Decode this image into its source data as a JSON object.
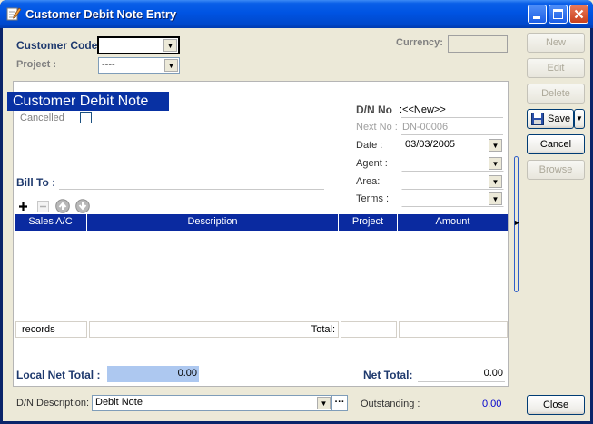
{
  "window": {
    "title": "Customer Debit Note Entry",
    "icon": "edit-icon"
  },
  "header": {
    "customer_code_label": "Customer Code:",
    "customer_code_value": "",
    "project_label": "Project :",
    "project_value": "----",
    "currency_label": "Currency:",
    "currency_value": ""
  },
  "panel": {
    "title": "Customer Debit Note",
    "cancelled_label": "Cancelled",
    "dn_no_label": "D/N No",
    "dn_no_value": ":<<New>>",
    "next_no_label": "Next No :",
    "next_no_value": "DN-00006",
    "date_label": "Date :",
    "date_value": "03/03/2005",
    "agent_label": "Agent :",
    "agent_value": "",
    "area_label": "Area:",
    "area_value": "",
    "terms_label": "Terms :",
    "terms_value": "",
    "bill_to_label": "Bill To :"
  },
  "grid": {
    "columns": [
      "Sales A/C",
      "Description",
      "Project",
      "Amount"
    ],
    "rows": [],
    "footer_records": "records",
    "footer_total_label": "Total:",
    "footer_total_value": ""
  },
  "totals": {
    "local_net_total_label": "Local Net Total :",
    "local_net_total_value": "0.00",
    "net_total_label": "Net Total:",
    "net_total_value": "0.00"
  },
  "bottom": {
    "description_label": "D/N Description:",
    "description_value": "Debit Note",
    "ellipsis": "···",
    "outstanding_label": "Outstanding :",
    "outstanding_value": "0.00"
  },
  "side_buttons": {
    "new": "New",
    "edit": "Edit",
    "delete": "Delete",
    "save": "Save",
    "cancel": "Cancel",
    "browse": "Browse",
    "close": "Close"
  },
  "colors": {
    "title_bar": "#0054e3",
    "panel_title_bg": "#0831a3",
    "grid_header_bg": "#0a2aa0",
    "local_total_bg": "#adc8f0",
    "outstanding_value": "#0000cc"
  }
}
